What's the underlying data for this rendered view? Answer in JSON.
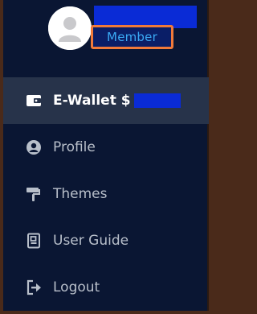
{
  "profile": {
    "role_badge": "Member",
    "avatar_alt": "avatar"
  },
  "menu": {
    "items": [
      {
        "label": "E-Wallet $",
        "icon": "wallet-icon",
        "active": true
      },
      {
        "label": "Profile",
        "icon": "user-circle-icon",
        "active": false
      },
      {
        "label": "Themes",
        "icon": "paint-roller-icon",
        "active": false
      },
      {
        "label": "User Guide",
        "icon": "guide-document-icon",
        "active": false
      },
      {
        "label": "Logout",
        "icon": "logout-icon",
        "active": false
      }
    ]
  },
  "colors": {
    "sidebar_bg": "#0a1633",
    "active_bg": "#27334a",
    "badge_border": "#f07a3a",
    "badge_text": "#3aa9f4",
    "redaction": "#0a2bd6"
  }
}
